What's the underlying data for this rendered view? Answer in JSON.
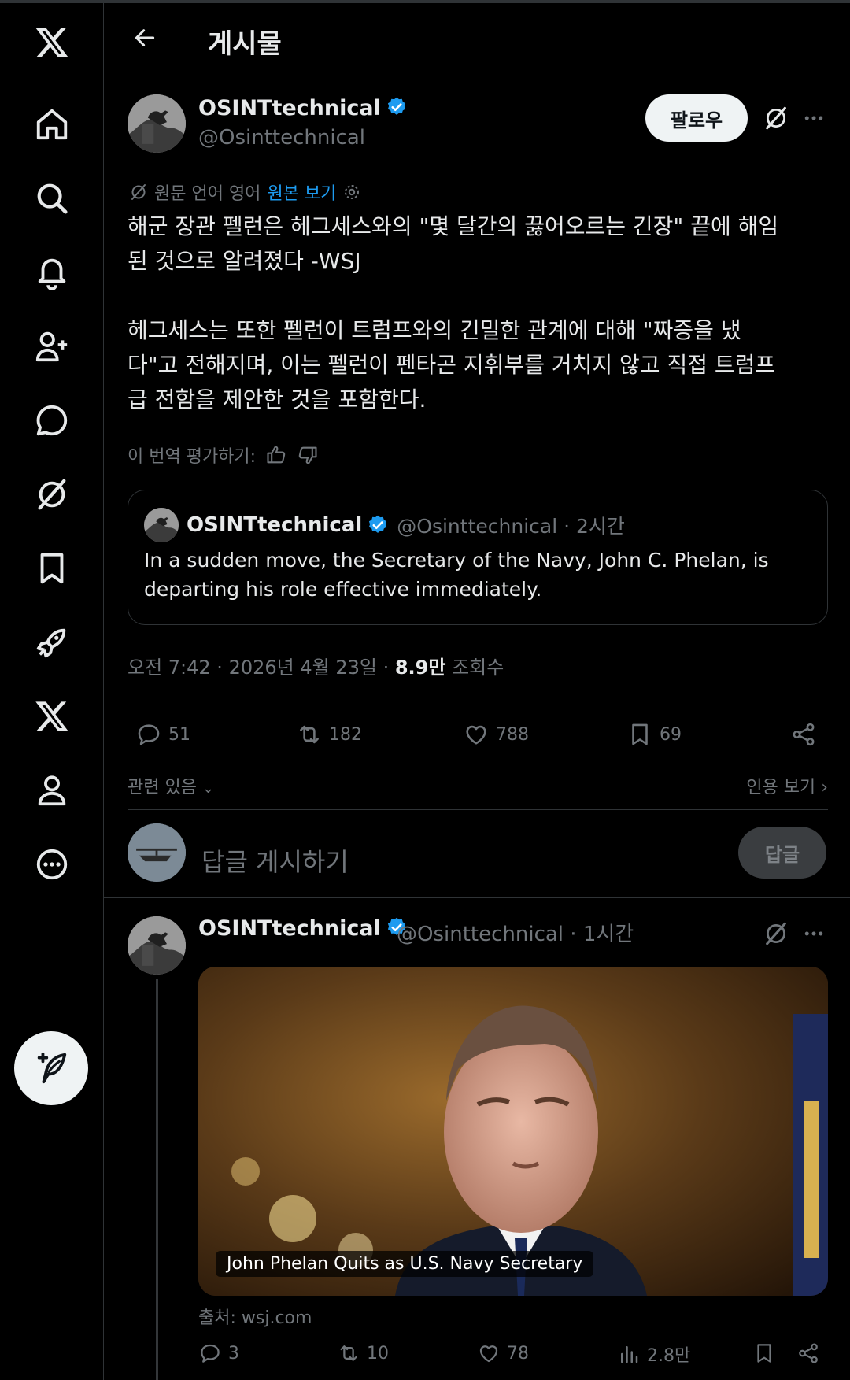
{
  "header": {
    "title": "게시물"
  },
  "post": {
    "display_name": "OSINTtechnical",
    "handle": "@Osinttechnical",
    "follow_label": "팔로우",
    "translation_note": "원문 언어 영어",
    "show_original": "원본 보기",
    "text": "해군 장관 펠런은 헤그세스와의 \"몇 달간의 끓어오르는 긴장\" 끝에 해임\n된 것으로 알려졌다 -WSJ\n\n헤그세스는 또한 펠런이 트럼프와의 긴밀한 관계에 대해 \"짜증을 냈\n다\"고 전해지며, 이는 펠런이 펜타곤 지휘부를 거치지 않고 직접 트럼프\n급 전함을 제안한 것을 포함한다.",
    "rate_translation": "이 번역 평가하기:",
    "quote": {
      "display_name": "OSINTtechnical",
      "handle_time": "@Osinttechnical · 2시간",
      "text": "In a sudden move, the Secretary of the Navy, John C. Phelan, is departing his role effective immediately."
    },
    "meta_time": "오전 7:42 · 2026년 4월 23일 · ",
    "views_count": "8.9만",
    "views_label": " 조회수",
    "replies": "51",
    "reposts": "182",
    "likes": "788",
    "bookmarks": "69",
    "related_label": "관련 있음",
    "view_quotes_label": "인용 보기"
  },
  "reply_box": {
    "placeholder": "답글 게시하기",
    "button_label": "답글"
  },
  "reply_post": {
    "display_name": "OSINTtechnical",
    "handle_time": "@Osinttechnical · 1시간",
    "card_caption": "John Phelan Quits as U.S. Navy Secretary",
    "source": "출처: wsj.com",
    "replies": "3",
    "reposts": "10",
    "likes": "78",
    "views": "2.8만"
  },
  "colors": {
    "accent": "#1d9bf0",
    "background": "#000000",
    "muted": "#71767b",
    "border": "#2f3336"
  },
  "icons": [
    "x-logo-icon",
    "home-icon",
    "search-icon",
    "bell-icon",
    "add-person-icon",
    "chat-icon",
    "grok-icon",
    "bookmark-icon",
    "rocket-icon",
    "x-premium-icon",
    "profile-icon",
    "more-circle-icon",
    "compose-icon"
  ]
}
